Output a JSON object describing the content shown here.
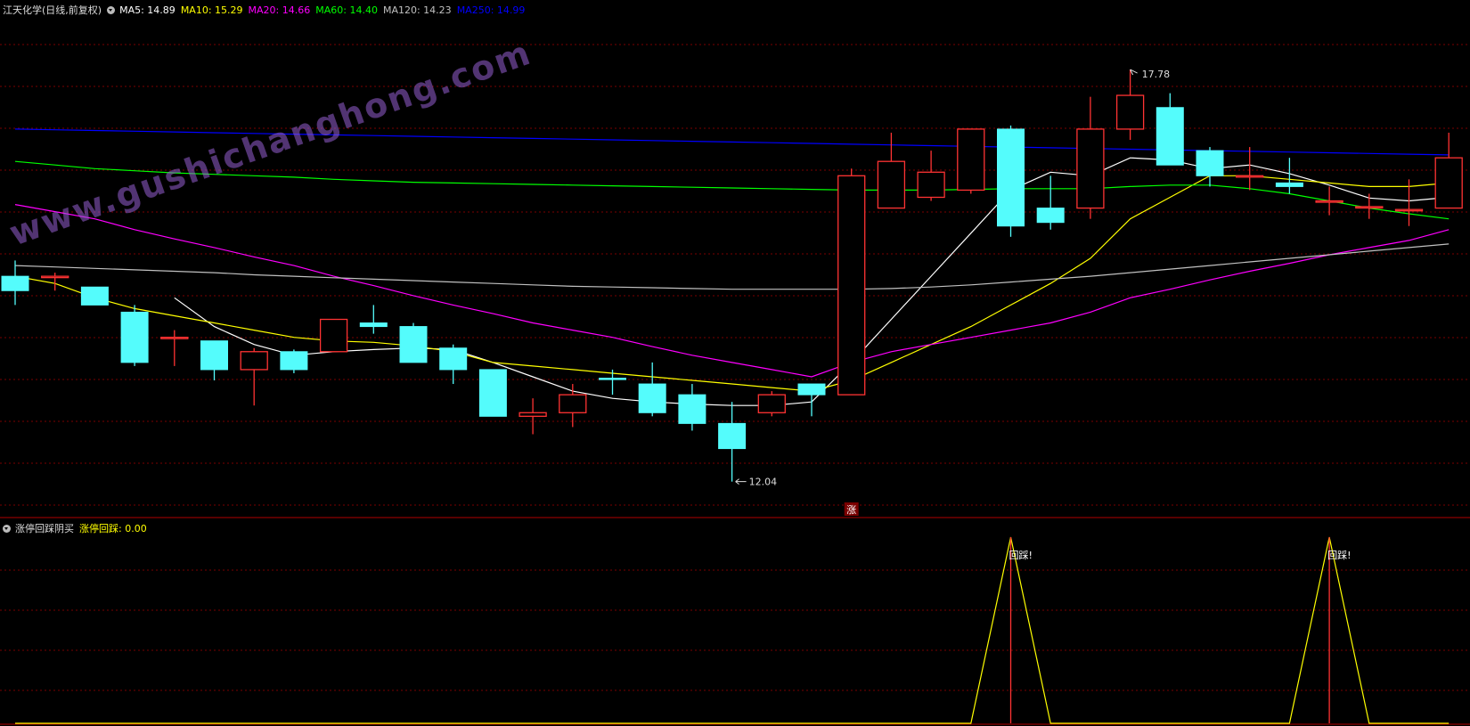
{
  "header": {
    "stock": "江天化学(日线,前复权)",
    "ma": [
      {
        "label": "MA5: 14.89",
        "color": "#ffffff"
      },
      {
        "label": "MA10: 15.29",
        "color": "#ffff00"
      },
      {
        "label": "MA20: 14.66",
        "color": "#ff00ff"
      },
      {
        "label": "MA60: 14.40",
        "color": "#00ff00"
      },
      {
        "label": "MA120: 14.23",
        "color": "#c0c0c0"
      },
      {
        "label": "MA250: 14.99",
        "color": "#0000ff"
      }
    ]
  },
  "sub_header": {
    "indicator": "涨停回踩阴买",
    "value_label": "涨停回踩: 0.00"
  },
  "watermark": "www.gushichanghong.com",
  "colors": {
    "up": "#ff3333",
    "down": "#54fcfc",
    "grid": "#7a0000",
    "ma5": "#ffffff",
    "ma10": "#ffff00",
    "ma20": "#ff00ff",
    "ma60": "#00ff00",
    "ma120": "#c0c0c0",
    "ma250": "#0000ff",
    "signal": "#ffff00",
    "signal_mark": "#ff3333"
  },
  "chart_data": [
    {
      "type": "candlestick",
      "title": "江天化学(日线,前复权)",
      "ylim": [
        11.8,
        18.5
      ],
      "annotations": {
        "high_label": "17.78",
        "high_index": 28,
        "low_label": "12.04",
        "low_index": 18,
        "limit_up_marker": "涨",
        "limit_up_index": 21
      },
      "candles": [
        {
          "o": 14.9,
          "h": 15.12,
          "l": 14.5,
          "c": 14.7
        },
        {
          "o": 14.9,
          "h": 14.95,
          "l": 14.7,
          "c": 14.9
        },
        {
          "o": 14.75,
          "h": 14.75,
          "l": 14.5,
          "c": 14.5
        },
        {
          "o": 14.4,
          "h": 14.5,
          "l": 13.65,
          "c": 13.7
        },
        {
          "o": 14.05,
          "h": 14.15,
          "l": 13.65,
          "c": 14.05
        },
        {
          "o": 14.0,
          "h": 14.0,
          "l": 13.45,
          "c": 13.6
        },
        {
          "o": 13.6,
          "h": 13.9,
          "l": 13.1,
          "c": 13.85
        },
        {
          "o": 13.85,
          "h": 13.88,
          "l": 13.55,
          "c": 13.6
        },
        {
          "o": 13.85,
          "h": 14.3,
          "l": 13.85,
          "c": 14.3
        },
        {
          "o": 14.25,
          "h": 14.5,
          "l": 14.1,
          "c": 14.2
        },
        {
          "o": 14.2,
          "h": 14.25,
          "l": 13.7,
          "c": 13.7
        },
        {
          "o": 13.9,
          "h": 13.95,
          "l": 13.4,
          "c": 13.6
        },
        {
          "o": 13.6,
          "h": 13.6,
          "l": 12.95,
          "c": 12.95
        },
        {
          "o": 12.95,
          "h": 13.2,
          "l": 12.7,
          "c": 13.0
        },
        {
          "o": 13.0,
          "h": 13.4,
          "l": 12.8,
          "c": 13.25
        },
        {
          "o": 13.48,
          "h": 13.6,
          "l": 13.25,
          "c": 13.47
        },
        {
          "o": 13.4,
          "h": 13.7,
          "l": 12.95,
          "c": 13.0
        },
        {
          "o": 13.25,
          "h": 13.4,
          "l": 12.75,
          "c": 12.85
        },
        {
          "o": 12.85,
          "h": 13.15,
          "l": 12.04,
          "c": 12.5
        },
        {
          "o": 13.0,
          "h": 13.3,
          "l": 12.95,
          "c": 13.25
        },
        {
          "o": 13.4,
          "h": 13.4,
          "l": 12.95,
          "c": 13.25
        },
        {
          "o": 13.25,
          "h": 16.4,
          "l": 13.25,
          "c": 16.3
        },
        {
          "o": 15.85,
          "h": 16.9,
          "l": 15.9,
          "c": 16.5
        },
        {
          "o": 16.0,
          "h": 16.65,
          "l": 15.95,
          "c": 16.35
        },
        {
          "o": 16.1,
          "h": 16.95,
          "l": 16.05,
          "c": 16.95
        },
        {
          "o": 16.95,
          "h": 17.0,
          "l": 15.45,
          "c": 15.6
        },
        {
          "o": 15.85,
          "h": 16.3,
          "l": 15.55,
          "c": 15.65
        },
        {
          "o": 15.85,
          "h": 17.4,
          "l": 15.7,
          "c": 16.95
        },
        {
          "o": 16.95,
          "h": 17.78,
          "l": 16.8,
          "c": 17.42
        },
        {
          "o": 17.25,
          "h": 17.45,
          "l": 16.45,
          "c": 16.45
        },
        {
          "o": 16.65,
          "h": 16.7,
          "l": 16.15,
          "c": 16.3
        },
        {
          "o": 16.3,
          "h": 16.7,
          "l": 16.1,
          "c": 16.3
        },
        {
          "o": 16.2,
          "h": 16.55,
          "l": 16.05,
          "c": 16.15
        },
        {
          "o": 15.95,
          "h": 16.15,
          "l": 15.75,
          "c": 15.95
        },
        {
          "o": 15.87,
          "h": 16.05,
          "l": 15.7,
          "c": 15.87
        },
        {
          "o": 15.83,
          "h": 16.25,
          "l": 15.6,
          "c": 15.83
        },
        {
          "o": 15.85,
          "h": 16.9,
          "l": 15.85,
          "c": 16.55
        }
      ],
      "ma_series": [
        {
          "name": "MA5",
          "key": "ma5",
          "values": [
            null,
            null,
            null,
            null,
            14.6,
            14.2,
            13.95,
            13.8,
            13.85,
            13.88,
            13.9,
            13.88,
            13.7,
            13.5,
            13.3,
            13.2,
            13.15,
            13.12,
            13.1,
            13.1,
            13.15,
            13.7,
            14.3,
            14.9,
            15.5,
            16.1,
            16.35,
            16.3,
            16.55,
            16.52,
            16.4,
            16.45,
            16.33,
            16.17,
            15.99,
            15.95,
            16.0
          ]
        },
        {
          "name": "MA10",
          "key": "ma10",
          "values": [
            14.9,
            14.8,
            14.6,
            14.45,
            14.35,
            14.25,
            14.15,
            14.05,
            14.0,
            13.98,
            13.93,
            13.85,
            13.7,
            13.65,
            13.6,
            13.55,
            13.5,
            13.45,
            13.4,
            13.35,
            13.3,
            13.45,
            13.7,
            13.95,
            14.2,
            14.5,
            14.8,
            15.15,
            15.7,
            16.0,
            16.3,
            16.3,
            16.25,
            16.2,
            16.15,
            16.15,
            16.2
          ]
        },
        {
          "name": "MA20",
          "key": "ma20",
          "values": [
            15.9,
            15.8,
            15.7,
            15.55,
            15.42,
            15.3,
            15.17,
            15.05,
            14.9,
            14.77,
            14.63,
            14.5,
            14.38,
            14.25,
            14.15,
            14.05,
            13.92,
            13.8,
            13.7,
            13.6,
            13.5,
            13.7,
            13.85,
            13.95,
            14.05,
            14.15,
            14.25,
            14.4,
            14.6,
            14.72,
            14.85,
            14.97,
            15.08,
            15.2,
            15.3,
            15.4,
            15.55
          ]
        },
        {
          "name": "MA60",
          "key": "ma60",
          "values": [
            16.5,
            16.45,
            16.4,
            16.37,
            16.34,
            16.32,
            16.3,
            16.28,
            16.25,
            16.23,
            16.21,
            16.2,
            16.19,
            16.18,
            16.17,
            16.16,
            16.15,
            16.14,
            16.13,
            16.12,
            16.11,
            16.1,
            16.1,
            16.1,
            16.11,
            16.12,
            16.12,
            16.12,
            16.15,
            16.17,
            16.17,
            16.12,
            16.05,
            15.95,
            15.85,
            15.77,
            15.7
          ]
        },
        {
          "name": "MA120",
          "key": "ma120",
          "values": [
            15.05,
            15.03,
            15.01,
            14.99,
            14.97,
            14.95,
            14.92,
            14.9,
            14.88,
            14.86,
            14.84,
            14.82,
            14.8,
            14.78,
            14.76,
            14.75,
            14.74,
            14.73,
            14.72,
            14.72,
            14.72,
            14.72,
            14.73,
            14.75,
            14.78,
            14.82,
            14.86,
            14.9,
            14.95,
            15.0,
            15.05,
            15.1,
            15.15,
            15.2,
            15.25,
            15.3,
            15.35
          ]
        },
        {
          "name": "MA250",
          "key": "ma250",
          "values": [
            16.95,
            16.94,
            16.93,
            16.92,
            16.91,
            16.9,
            16.89,
            16.88,
            16.87,
            16.86,
            16.85,
            16.84,
            16.83,
            16.82,
            16.81,
            16.8,
            16.79,
            16.78,
            16.77,
            16.76,
            16.75,
            16.74,
            16.73,
            16.72,
            16.71,
            16.7,
            16.69,
            16.68,
            16.67,
            16.66,
            16.65,
            16.64,
            16.63,
            16.62,
            16.61,
            16.6,
            16.59
          ]
        }
      ]
    },
    {
      "type": "line",
      "title": "涨停回踩阴买",
      "ylim": [
        0,
        1
      ],
      "x_index_count": 37,
      "series": [
        {
          "name": "涨停回踩",
          "values": [
            0,
            0,
            0,
            0,
            0,
            0,
            0,
            0,
            0,
            0,
            0,
            0,
            0,
            0,
            0,
            0,
            0,
            0,
            0,
            0,
            0,
            0,
            0,
            0,
            0,
            1,
            0,
            0,
            0,
            0,
            0,
            0,
            0,
            1,
            0,
            0,
            0
          ]
        }
      ],
      "signal_label": "回踩!"
    }
  ]
}
